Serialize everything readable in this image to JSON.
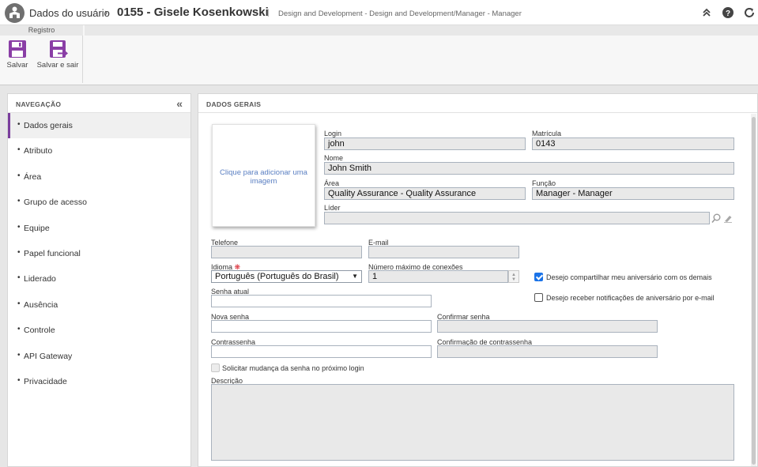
{
  "titlebar": {
    "crumb": "Dados do usuário",
    "separator": "›",
    "record": "0155 - Gisele Kosenkowski",
    "bar": "|",
    "path": "Design and Development - Design and Development/Manager - Manager"
  },
  "ribbon": {
    "group_label": "Registro",
    "save_label": "Salvar",
    "save_exit_label": "Salvar e sair"
  },
  "nav": {
    "title": "NAVEGAÇÃO",
    "collapse": "«",
    "items": [
      {
        "label": "Dados gerais",
        "active": true
      },
      {
        "label": "Atributo"
      },
      {
        "label": "Área"
      },
      {
        "label": "Grupo de acesso"
      },
      {
        "label": "Equipe"
      },
      {
        "label": "Papel funcional"
      },
      {
        "label": "Liderado"
      },
      {
        "label": "Ausência"
      },
      {
        "label": "Controle"
      },
      {
        "label": "API Gateway"
      },
      {
        "label": "Privacidade"
      }
    ]
  },
  "main": {
    "title": "DADOS GERAIS",
    "photo_text": "Clique para adicionar uma imagem"
  },
  "form": {
    "login_label": "Login",
    "login_value": "john",
    "matricula_label": "Matrícula",
    "matricula_value": "0143",
    "nome_label": "Nome",
    "nome_value": "John Smith",
    "area_label": "Área",
    "area_value": "Quality Assurance - Quality Assurance",
    "funcao_label": "Função",
    "funcao_value": "Manager - Manager",
    "lider_label": "Líder",
    "lider_value": "",
    "telefone_label": "Telefone",
    "telefone_value": "",
    "email_label": "E-mail",
    "email_value": "",
    "idioma_label": "Idioma",
    "idioma_value": "Português (Português do Brasil)",
    "conexoes_label": "Número máximo de conexões",
    "conexoes_value": "1",
    "senha_atual_label": "Senha atual",
    "nova_senha_label": "Nova senha",
    "confirmar_senha_label": "Confirmar senha",
    "contrassenha_label": "Contrassenha",
    "confirmacao_contrassenha_label": "Confirmação de contrassenha",
    "share_birthday_label": "Desejo compartilhar meu aniversário com os demais",
    "share_birthday_checked": true,
    "receive_birthday_label": "Desejo receber notificações de aniversário por e-mail",
    "receive_birthday_checked": false,
    "change_password_label": "Solicitar mudança da senha no próximo login",
    "change_password_checked": false,
    "descricao_label": "Descrição"
  },
  "colors": {
    "accent": "#7a3e9d",
    "link": "#5a7fc2",
    "checkbox": "#1a73e8",
    "required": "#d9232e"
  }
}
